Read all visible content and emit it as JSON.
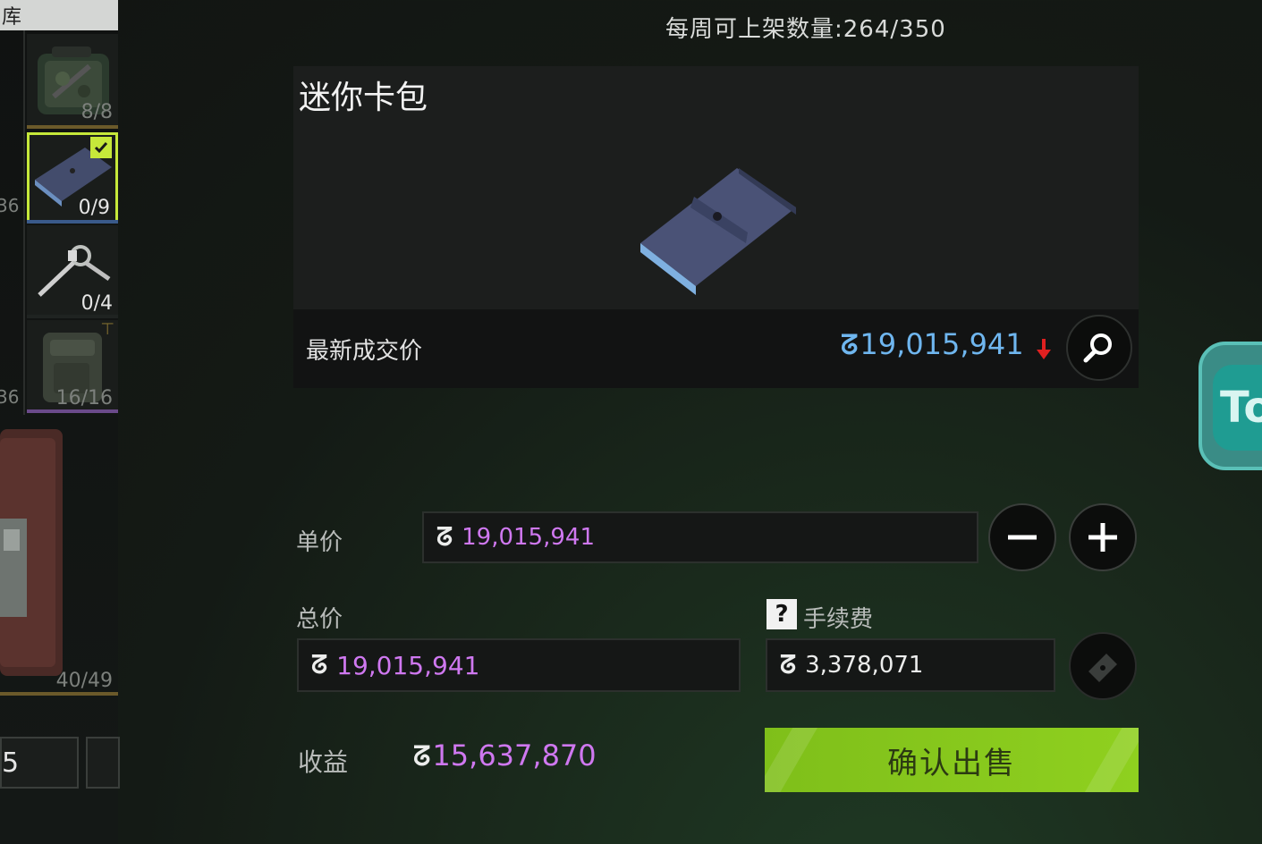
{
  "inventory": {
    "tab_label": "库",
    "slots": [
      {
        "name": "camo-bag",
        "count": "8/8"
      },
      {
        "name": "mini-card-wallet",
        "count": "0/9",
        "selected": true
      },
      {
        "name": "keys",
        "count": "0/4"
      },
      {
        "name": "pouch",
        "count": "16/16"
      },
      {
        "name": "case",
        "count": "40/49"
      }
    ],
    "side_numbers": [
      "36",
      "36"
    ],
    "bottom_value": "5"
  },
  "header": {
    "weekly_limit": "每周可上架数量:264/350"
  },
  "item": {
    "name": "迷你卡包",
    "latest_price_label": "最新成交价",
    "latest_price": "19,015,941",
    "price_trend": "down"
  },
  "form": {
    "unit_price_label": "单价",
    "unit_price": "19,015,941",
    "total_price_label": "总价",
    "total_price": "19,015,941",
    "fee_help": "?",
    "fee_label": "手续费",
    "fee": "3,378,071",
    "income_label": "收益",
    "income": "15,637,870",
    "currency_symbol": "ᘔ",
    "confirm_label": "确认出售"
  },
  "side_button": {
    "label": "To"
  },
  "colors": {
    "accent_green": "#8fd01f",
    "price_blue": "#6fb6ef",
    "value_purple": "#cf78f0",
    "trend_red": "#e02020",
    "selected_slot": "#c6e83a"
  }
}
